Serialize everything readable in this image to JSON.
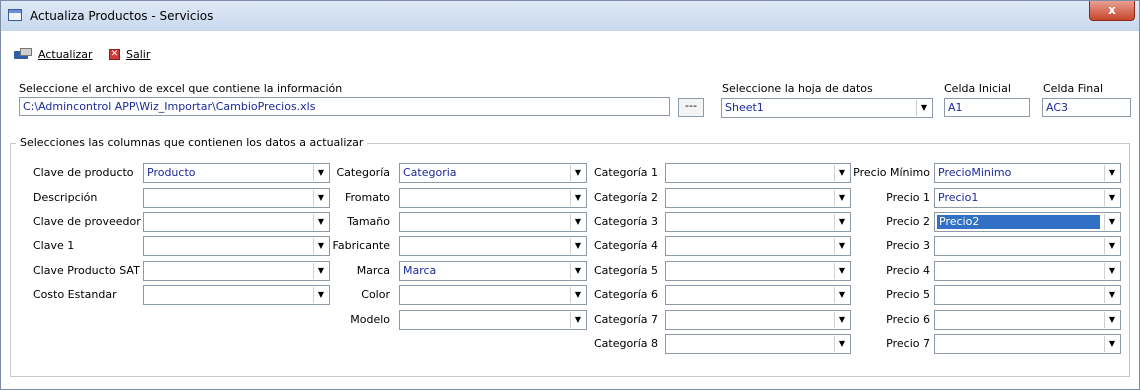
{
  "window": {
    "title": "Actualiza Productos - Servicios",
    "close_label": "x"
  },
  "toolbar": {
    "actualizar": "Actualizar",
    "salir": "Salir"
  },
  "file": {
    "label": "Seleccione el archivo de excel que contiene la información",
    "path": "C:\\Admincontrol APP\\Wiz_Importar\\CambioPrecios.xls",
    "browse_label": "---"
  },
  "sheet": {
    "label": "Seleccione la hoja de datos",
    "value": "Sheet1"
  },
  "celda_inicial": {
    "label": "Celda Inicial",
    "value": "A1"
  },
  "celda_final": {
    "label": "Celda Final",
    "value": "AC3"
  },
  "group": {
    "title": "Selecciones las columnas que contienen los datos a actualizar"
  },
  "col1": [
    {
      "label": "Clave de producto",
      "value": "Producto"
    },
    {
      "label": "Descripción",
      "value": ""
    },
    {
      "label": "Clave de proveedor",
      "value": ""
    },
    {
      "label": "Clave 1",
      "value": ""
    },
    {
      "label": "Clave Producto SAT",
      "value": ""
    },
    {
      "label": "Costo Estandar",
      "value": ""
    }
  ],
  "col2": [
    {
      "label": "Categoría",
      "value": "Categoria"
    },
    {
      "label": "Fromato",
      "value": ""
    },
    {
      "label": "Tamaño",
      "value": ""
    },
    {
      "label": "Fabricante",
      "value": ""
    },
    {
      "label": "Marca",
      "value": "Marca"
    },
    {
      "label": "Color",
      "value": ""
    },
    {
      "label": "Modelo",
      "value": ""
    }
  ],
  "col3": [
    {
      "label": "Categoría 1",
      "value": ""
    },
    {
      "label": "Categoría 2",
      "value": ""
    },
    {
      "label": "Categoría 3",
      "value": ""
    },
    {
      "label": "Categoría 4",
      "value": ""
    },
    {
      "label": "Categoría 5",
      "value": ""
    },
    {
      "label": "Categoría 6",
      "value": ""
    },
    {
      "label": "Categoría 7",
      "value": ""
    },
    {
      "label": "Categoría 8",
      "value": ""
    }
  ],
  "col4": [
    {
      "label": "Precio Mínimo",
      "value": "PrecioMinimo"
    },
    {
      "label": "Precio 1",
      "value": "Precio1"
    },
    {
      "label": "Precio 2",
      "value": "Precio2"
    },
    {
      "label": "Precio 3",
      "value": ""
    },
    {
      "label": "Precio 4",
      "value": ""
    },
    {
      "label": "Precio 5",
      "value": ""
    },
    {
      "label": "Precio 6",
      "value": ""
    },
    {
      "label": "Precio 7",
      "value": ""
    }
  ],
  "selection_color": "#3270c6"
}
